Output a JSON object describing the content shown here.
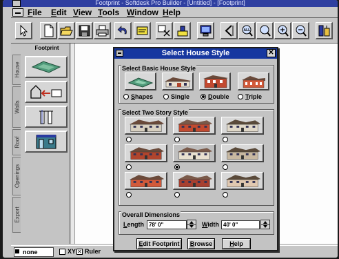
{
  "app": {
    "title": "Footprint - Softdesk Pro Builder - [Untitled] - [Footprint]"
  },
  "menu": [
    {
      "label": "File",
      "ul": "F",
      "rest": "ile"
    },
    {
      "label": "Edit",
      "ul": "E",
      "rest": "dit"
    },
    {
      "label": "View",
      "ul": "V",
      "rest": "iew"
    },
    {
      "label": "Tools",
      "ul": "T",
      "rest": "ools"
    },
    {
      "label": "Window",
      "ul": "W",
      "rest": "indow"
    },
    {
      "label": "Help",
      "ul": "H",
      "rest": "elp"
    }
  ],
  "toolbar": {
    "buttons": [
      "pointer-icon",
      "new-document-icon",
      "open-folder-icon",
      "save-disk-icon",
      "print-icon",
      "undo-icon",
      "note-icon",
      "insert-icon",
      "wall-tool-icon",
      "monitor-icon",
      "plan-view-icon",
      "zoom-all-icon",
      "zoom-icon",
      "zoom-in-icon",
      "zoom-out-icon",
      "level-icon"
    ],
    "zoom_all_label": "ALL"
  },
  "left_panel": {
    "title": "Footprint",
    "tabs": [
      "House",
      "Walls",
      "Roof",
      "Openings",
      "Export"
    ],
    "tool_buttons": [
      "footprint-shape-icon",
      "wall-room-icon",
      "dimension-icon",
      "building-icon"
    ]
  },
  "status_bar": {
    "layer": "none",
    "xy_label": "XY",
    "ruler_label": "Ruler",
    "ruler_checked": true
  },
  "dialog": {
    "title": "Select House Style",
    "basic_style": {
      "label": "Select Basic House Style",
      "options": [
        {
          "label": "Shapes",
          "ul": "S",
          "rest": "hapes",
          "selected": false
        },
        {
          "label": "Single",
          "ul": "",
          "rest": "Single",
          "selected": false
        },
        {
          "label": "Double",
          "ul": "D",
          "rest": "ouble",
          "selected": true
        },
        {
          "label": "Triple",
          "ul": "T",
          "rest": "riple",
          "selected": false
        }
      ]
    },
    "two_story": {
      "label": "Select Two Story Style",
      "selected_index": 4,
      "count": 9
    },
    "dimensions": {
      "label": "Overall Dimensions",
      "length_label": "Length",
      "length_value": "78' 0\"",
      "width_label": "Width",
      "width_value": "40' 0\""
    },
    "buttons": {
      "edit_footprint": "Edit Footprint",
      "browse": "Browse",
      "help": "Help"
    }
  },
  "colors": {
    "dialog_title_bg": "#1637a0",
    "house_brick": "#b0452d",
    "house_roof": "#6a4a3a",
    "footprint_green": "#4f9a7a"
  }
}
